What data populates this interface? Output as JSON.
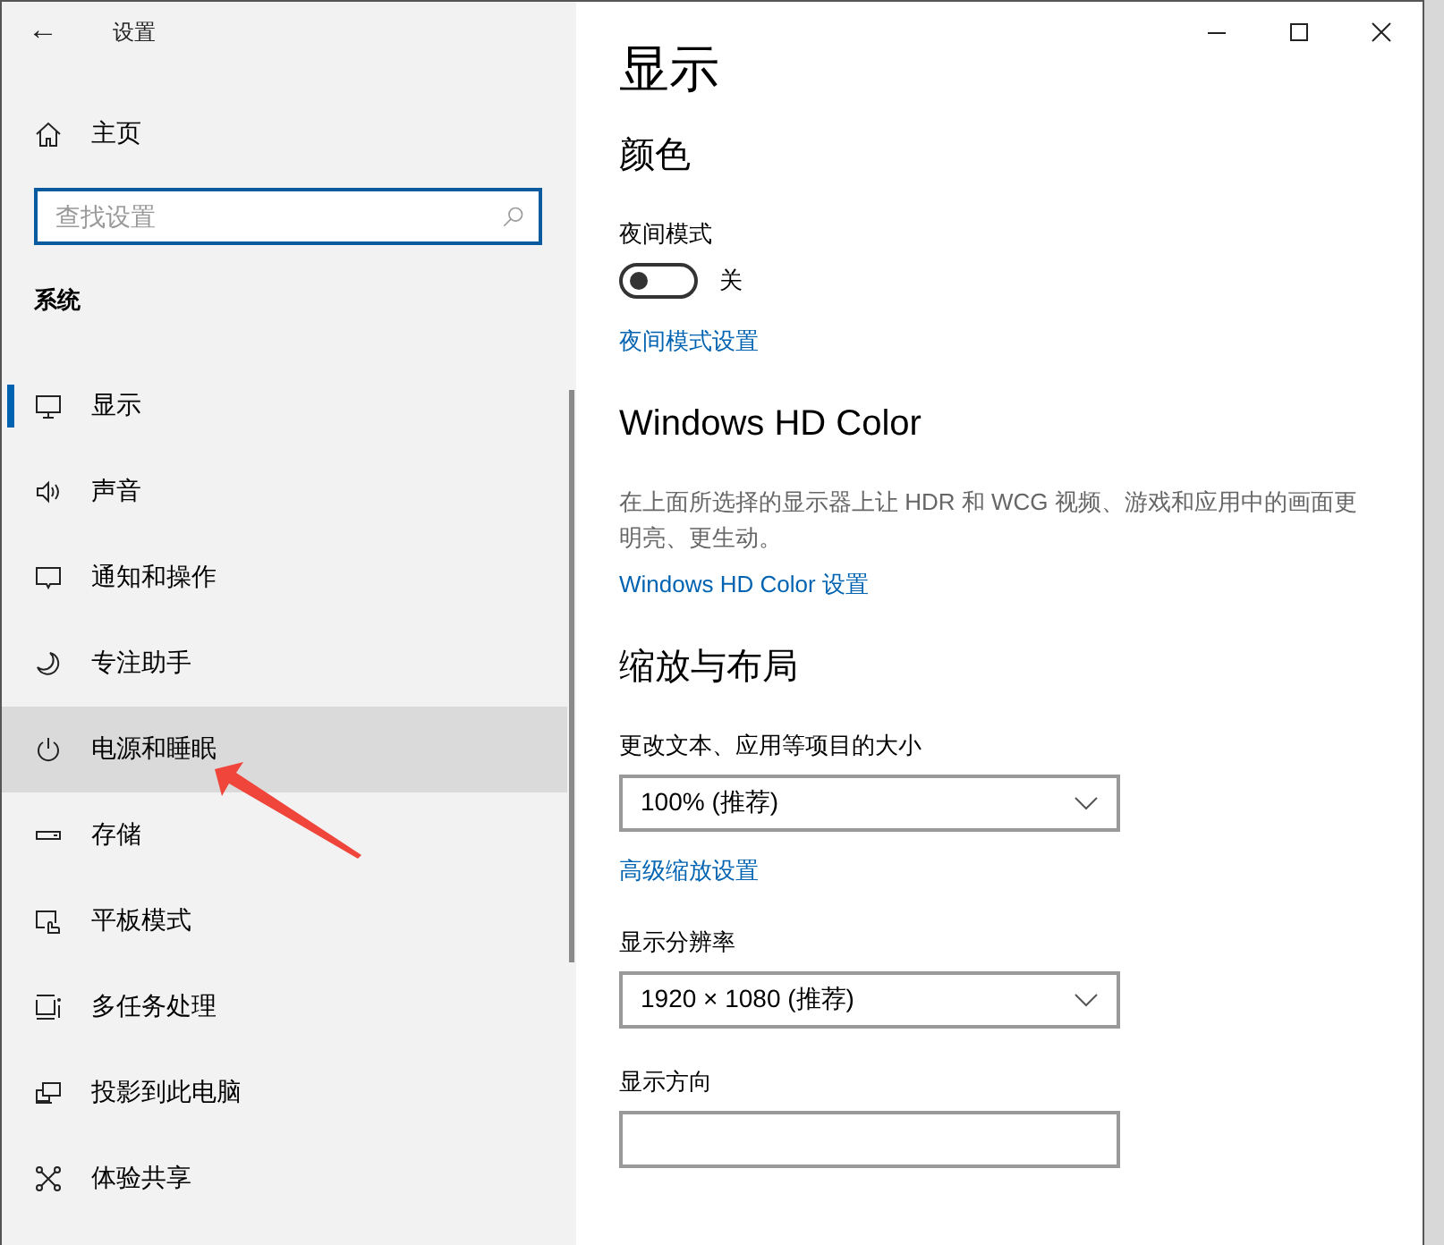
{
  "window": {
    "title": "设置",
    "back": "←"
  },
  "sidebar": {
    "home": "主页",
    "search": {
      "placeholder": "查找设置"
    },
    "section": "系统",
    "items": [
      {
        "label": "显示",
        "selected": true,
        "highlighted": false
      },
      {
        "label": "声音",
        "selected": false,
        "highlighted": false
      },
      {
        "label": "通知和操作",
        "selected": false,
        "highlighted": false
      },
      {
        "label": "专注助手",
        "selected": false,
        "highlighted": false
      },
      {
        "label": "电源和睡眠",
        "selected": false,
        "highlighted": true
      },
      {
        "label": "存储",
        "selected": false,
        "highlighted": false
      },
      {
        "label": "平板模式",
        "selected": false,
        "highlighted": false
      },
      {
        "label": "多任务处理",
        "selected": false,
        "highlighted": false
      },
      {
        "label": "投影到此电脑",
        "selected": false,
        "highlighted": false
      },
      {
        "label": "体验共享",
        "selected": false,
        "highlighted": false
      }
    ]
  },
  "content": {
    "title": "显示",
    "blocks": [
      {
        "kind": "heading",
        "text": "颜色"
      },
      {
        "kind": "label",
        "text": "夜间模式"
      },
      {
        "kind": "toggle",
        "on": false,
        "text": "关"
      },
      {
        "kind": "link",
        "text": "夜间模式设置"
      },
      {
        "kind": "heading",
        "text": "Windows HD Color"
      },
      {
        "kind": "text",
        "text": "在上面所选择的显示器上让 HDR 和 WCG 视频、游戏和应用中的画面更明亮、更生动。"
      },
      {
        "kind": "link",
        "text": "Windows HD Color 设置"
      },
      {
        "kind": "heading",
        "text": "缩放与布局"
      },
      {
        "kind": "label",
        "text": "更改文本、应用等项目的大小"
      },
      {
        "kind": "dropdown",
        "value": "100% (推荐)"
      },
      {
        "kind": "link",
        "text": "高级缩放设置"
      },
      {
        "kind": "label",
        "text": "显示分辨率"
      },
      {
        "kind": "dropdown",
        "value": "1920 × 1080 (推荐)"
      },
      {
        "kind": "label",
        "text": "显示方向"
      },
      {
        "kind": "dropdown"
      }
    ]
  }
}
